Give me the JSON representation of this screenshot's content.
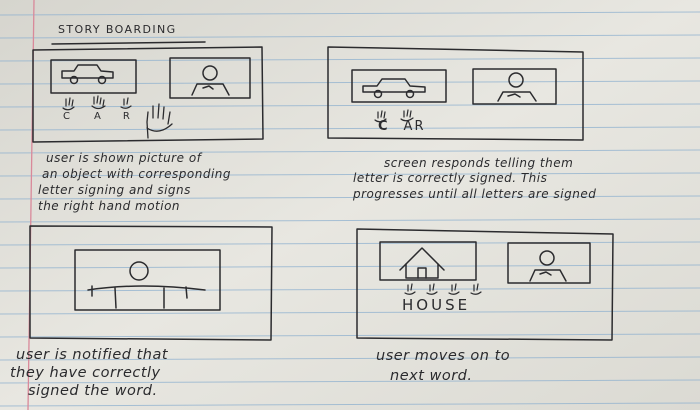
{
  "title": "STORY BOARDING",
  "panels": [
    {
      "id": "panel-1",
      "letters": [
        "C",
        "A",
        "R"
      ],
      "caption": [
        "user is shown picture of",
        "an object with corresponding",
        "letter signing and signs",
        "the right hand motion"
      ]
    },
    {
      "id": "panel-2",
      "letters": [
        "C",
        "A",
        "R"
      ],
      "caption": [
        "screen responds telling them",
        "letter is correctly signed. This",
        "progresses until all letters are signed"
      ]
    },
    {
      "id": "panel-3",
      "caption": [
        "user is notified that",
        "they have correctly",
        "signed the word."
      ]
    },
    {
      "id": "panel-4",
      "word": "HOUSE",
      "caption": [
        "user moves on to",
        "next word."
      ]
    }
  ],
  "colors": {
    "paper": "#e4e3dc",
    "rule": "#8fb1cf",
    "margin_line": "#d9899a",
    "ink": "#2b2b2e"
  }
}
